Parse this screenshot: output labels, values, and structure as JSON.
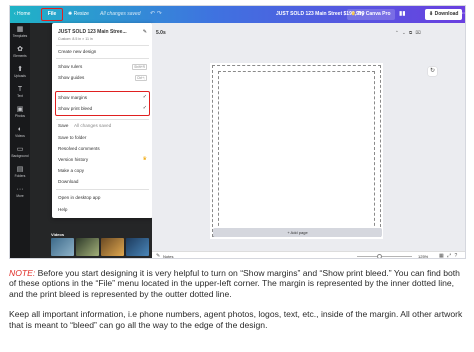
{
  "topbar": {
    "home": "‹ Home",
    "file": "File",
    "resize": "✺ Resize",
    "saved_status": "All changes saved",
    "undo_redo": "↶ ↷",
    "doc_title": "JUST SOLD 123 Main Street $199,999",
    "pro": "Try Canva Pro",
    "pro_icon": "♛",
    "stats_icon": "▮▮",
    "download": "⬇ Download",
    "more": "···"
  },
  "rail": [
    {
      "icon": "▦",
      "label": "Templates"
    },
    {
      "icon": "✿",
      "label": "Elements"
    },
    {
      "icon": "⬆",
      "label": "Uploads"
    },
    {
      "icon": "T",
      "label": "Text"
    },
    {
      "icon": "▣",
      "label": "Photos"
    },
    {
      "icon": "◐",
      "label": "Videos"
    },
    {
      "icon": "▭",
      "label": "Background"
    },
    {
      "icon": "▤",
      "label": "Folders"
    },
    {
      "icon": "···",
      "label": "More"
    }
  ],
  "panel": {
    "videos_label": "Videos"
  },
  "menu": {
    "title": "JUST SOLD 123 Main Stree...",
    "title_edit_icon": "✎",
    "title_sub": "Custom: 8.5 in × 11 in",
    "create_new": "Create new design",
    "show_rulers": "Show rulers",
    "show_rulers_kbd": "Shift+R",
    "show_guides": "Show guides",
    "show_guides_kbd": "Ctrl+;",
    "show_margins": "Show margins",
    "show_print_bleed": "Show print bleed",
    "check": "✓",
    "save": "Save",
    "save_status": "All changes saved",
    "save_to_folder": "Save to folder",
    "resolved_comments": "Resolved comments",
    "version_history": "Version history",
    "crown": "♛",
    "make_copy": "Make a copy",
    "download": "Download",
    "open_desktop": "Open in desktop app",
    "help": "Help"
  },
  "canvas": {
    "page_label": "5.0s",
    "page_tools": "⌃ ⌄ ⧉ ⌧",
    "refresh_icon": "↻",
    "add_page": "+ Add page"
  },
  "bottombar": {
    "notes_icon": "✎",
    "notes": "Notes",
    "zoom": "125%",
    "zoom_fraction": 0.4,
    "view_icons": "▦ ⤢ ?"
  },
  "caption": {
    "note_label": "NOTE:",
    "para1": " Before you start designing it is very helpful to turn on “Show margins” and “Show print bleed.” You can find both of these options in the “File” menu located in the upper-left corner. The margin is represented by the inner dotted line, and the print bleed is represented by the outter dotted line.",
    "para2": "Keep all important information, i.e phone numbers, agent photos, logos, text, etc., inside of the margin. All other artwork that is meant to “bleed” can go all the way to the edge of the design."
  },
  "colors": {
    "highlight": "#e02020",
    "note": "#e0302a",
    "topbar_start": "#1fb4c6",
    "topbar_end": "#6a3fe0"
  }
}
